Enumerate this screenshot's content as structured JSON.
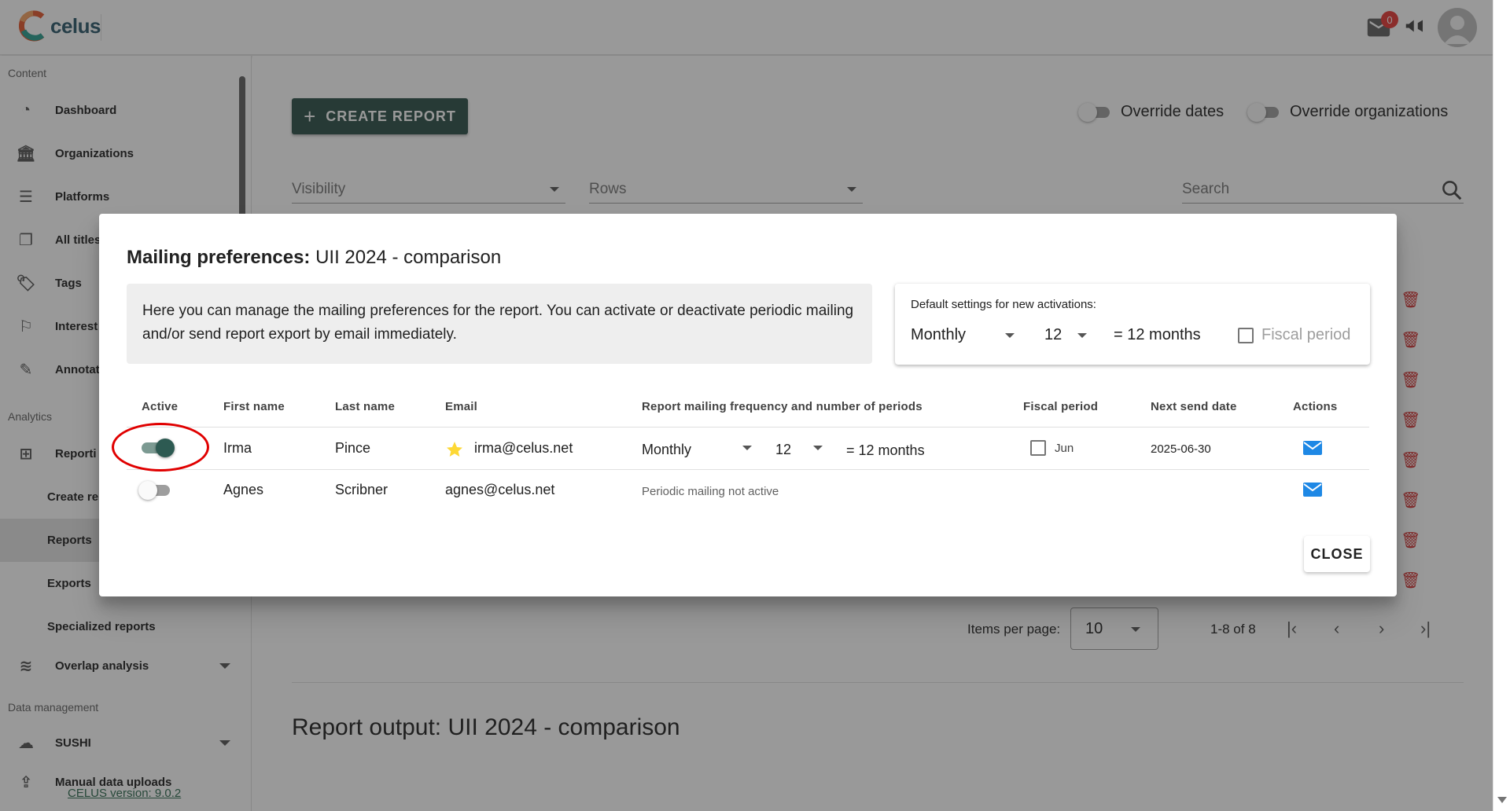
{
  "header": {
    "logo_text": "celus",
    "notification_count": "0"
  },
  "sidebar": {
    "sections": {
      "content": "Content",
      "analytics": "Analytics",
      "data_management": "Data management"
    },
    "items": [
      {
        "label": "Dashboard",
        "icon": "dashboard-icon"
      },
      {
        "label": "Organizations",
        "icon": "bank-icon"
      },
      {
        "label": "Platforms",
        "icon": "list-icon"
      },
      {
        "label": "All titles",
        "icon": "copy-icon"
      },
      {
        "label": "Tags",
        "icon": "tags-icon"
      },
      {
        "label": "Interest",
        "icon": "flag-icon"
      },
      {
        "label": "Annotat",
        "icon": "brush-icon"
      }
    ],
    "analytics": {
      "reporting": "Reporti",
      "create": "Create re",
      "reports": "Reports",
      "exports": "Exports",
      "specialized": "Specialized reports",
      "overlap": "Overlap analysis"
    },
    "data_mgmt": {
      "sushi": "SUSHI",
      "manual": "Manual data uploads"
    },
    "version": "CELUS version: 9.0.2"
  },
  "main": {
    "create_button": "CREATE REPORT",
    "override_dates": "Override dates",
    "override_orgs": "Override organizations",
    "visibility_placeholder": "Visibility",
    "rows_placeholder": "Rows",
    "search_placeholder": "Search",
    "items_per_page_label": "Items per page:",
    "items_per_page_value": "10",
    "page_range": "1-8 of 8",
    "report_output_label": "Report output:",
    "report_output_name": "UII 2024 - comparison"
  },
  "dialog": {
    "title_bold": "Mailing preferences:",
    "title_name": "UII 2024 - comparison",
    "info_text": "Here you can manage the mailing preferences for the report. You can activate or deactivate periodic mailing and/or send report export by email immediately.",
    "defaults": {
      "label": "Default settings for new activations:",
      "frequency": "Monthly",
      "periods": "12",
      "summary": "= 12 months",
      "fiscal_label": "Fiscal period"
    },
    "columns": {
      "active": "Active",
      "first_name": "First name",
      "last_name": "Last name",
      "email": "Email",
      "frequency": "Report mailing frequency and number of periods",
      "fiscal": "Fiscal period",
      "next_send": "Next send date",
      "actions": "Actions"
    },
    "rows": [
      {
        "active": true,
        "first_name": "Irma",
        "last_name": "Pince",
        "email": "irma@celus.net",
        "frequency": "Monthly",
        "periods": "12",
        "summary": "= 12 months",
        "fiscal": "Jun",
        "next_send": "2025-06-30"
      },
      {
        "active": false,
        "first_name": "Agnes",
        "last_name": "Scribner",
        "email": "agnes@celus.net",
        "status": "Periodic mailing not active"
      }
    ],
    "close_button": "CLOSE"
  },
  "colors": {
    "primary": "#2d5148",
    "accent_blue": "#1e88e5",
    "danger": "#d32f2f",
    "highlight": "#e00000"
  }
}
